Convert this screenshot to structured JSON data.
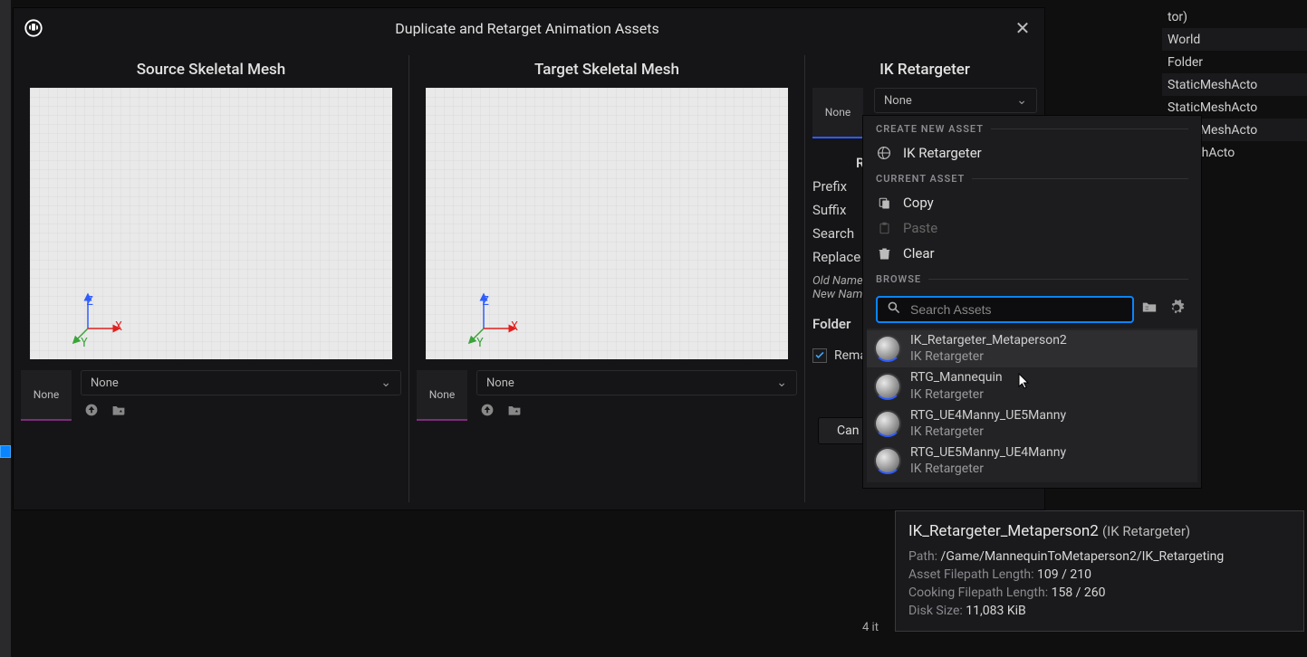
{
  "dialog": {
    "title": "Duplicate and Retarget Animation Assets",
    "source_panel_title": "Source Skeletal Mesh",
    "target_panel_title": "Target Skeletal Mesh",
    "ik_panel_title": "IK Retargeter",
    "none_label": "None",
    "rename_header": "Re",
    "prefix_label": "Prefix",
    "suffix_label": "Suffix",
    "search_label": "Search",
    "replace_label": "Replace",
    "old_name_label": "Old Name",
    "new_name_label": "New Nam",
    "folder_label": "Folder",
    "remap_label": "Remap",
    "cancel_label": "Can"
  },
  "outliner": {
    "items": [
      {
        "label": "tor)"
      },
      {
        "label": "World"
      },
      {
        "label": "Folder"
      },
      {
        "label": "StaticMeshActo"
      },
      {
        "label": "StaticMeshActo"
      },
      {
        "label": "StaticMeshActo"
      },
      {
        "label": "icMeshActo"
      }
    ]
  },
  "asset_picker": {
    "create_section": "CREATE NEW ASSET",
    "create_item": "IK Retargeter",
    "current_section": "CURRENT ASSET",
    "copy_label": "Copy",
    "paste_label": "Paste",
    "clear_label": "Clear",
    "browse_section": "BROWSE",
    "search_placeholder": "Search Assets",
    "assets": [
      {
        "name": "IK_Retargeter_Metaperson2",
        "type": "IK Retargeter"
      },
      {
        "name": "RTG_Mannequin",
        "type": "IK Retargeter"
      },
      {
        "name": "RTG_UE4Manny_UE5Manny",
        "type": "IK Retargeter"
      },
      {
        "name": "RTG_UE5Manny_UE4Manny",
        "type": "IK Retargeter"
      }
    ],
    "items_count": "4 it"
  },
  "tooltip": {
    "title": "IK_Retargeter_Metaperson2",
    "title_sub": "(IK Retargeter)",
    "path_label": "Path:",
    "path_value": "/Game/MannequinToMetaperson2/IK_Retargeting",
    "asset_len_label": "Asset Filepath Length:",
    "asset_len_value": "109 / 210",
    "cook_len_label": "Cooking Filepath Length:",
    "cook_len_value": "158 / 260",
    "disk_label": "Disk Size:",
    "disk_value": "11,083 KiB"
  }
}
